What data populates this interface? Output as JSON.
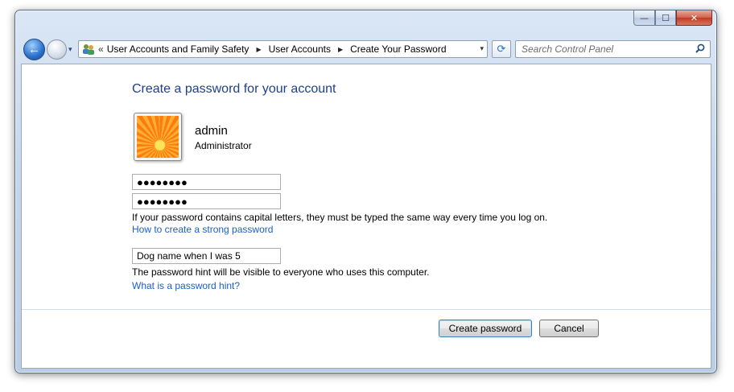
{
  "window": {
    "buttons": {
      "minimize": "—",
      "maximize": "☐",
      "close": "✕"
    }
  },
  "nav": {
    "back_icon": "←",
    "forward_icon": "→",
    "history_dropdown": "▾"
  },
  "address": {
    "icon": "control-panel-users-icon",
    "chevron": "«",
    "breadcrumbs": [
      "User Accounts and Family Safety",
      "User Accounts",
      "Create Your Password"
    ],
    "separator": "▶",
    "dropdown": "▾"
  },
  "refresh_icon": "⟳",
  "search": {
    "placeholder": "Search Control Panel",
    "icon": "⌕"
  },
  "main": {
    "title": "Create a password for your account",
    "user": {
      "name": "admin",
      "role": "Administrator"
    },
    "password_value": "●●●●●●●●",
    "confirm_value": "●●●●●●●●",
    "caps_note": "If your password contains capital letters, they must be typed the same way every time you log on.",
    "strong_link": "How to create a strong password",
    "hint_value": "Dog name when I was 5",
    "hint_note": "The password hint will be visible to everyone who uses this computer.",
    "hint_link": "What is a password hint?",
    "create_button": "Create password",
    "cancel_button": "Cancel"
  }
}
